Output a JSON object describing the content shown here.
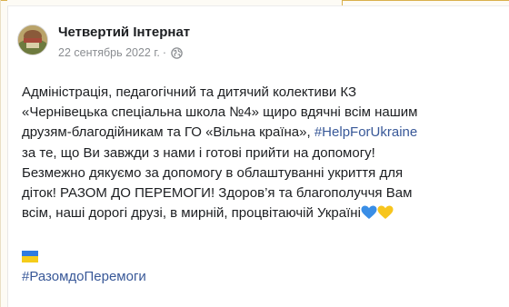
{
  "post": {
    "author": "Четвертий Інтернат",
    "date": "22 сентябрь 2022 г.",
    "separator": "·",
    "privacy_icon": "globe-icon",
    "lines": [
      "Адміністрація, педагогічний та дитячий колективи КЗ",
      "«Чернівецька спеціальна школа №4» щиро вдячні всім нашим",
      "друзям-благодійникам та ГО «Вільна країна»,",
      "за те, що Ви завжди з нами і готові прийти на допомогу!",
      "Безмежно дякуємо за допомогу в облаштуванні укриття для",
      "діток! РАЗОМ ДО ПЕРЕМОГИ! Здоров’я та благополуччя Вам",
      "всім, наші дорогі друзі, в мирній, процвітаючій Україні"
    ],
    "inline_hashtag": "#HelpForUkraine",
    "final_hashtag": "#РазомдоПеремоги",
    "emojis": [
      "blue-heart-icon",
      "yellow-heart-icon",
      "ukraine-flag-icon",
      "ukraine-flag-icon",
      "ukraine-flag-icon"
    ]
  },
  "colors": {
    "link": "#385898",
    "text": "#1c1e21",
    "meta": "#8a8d91",
    "flag_blue": "#2f7be0",
    "flag_yellow": "#f5cc1a",
    "heart_blue": "#3a8ee6",
    "heart_yellow": "#f7c51e"
  }
}
